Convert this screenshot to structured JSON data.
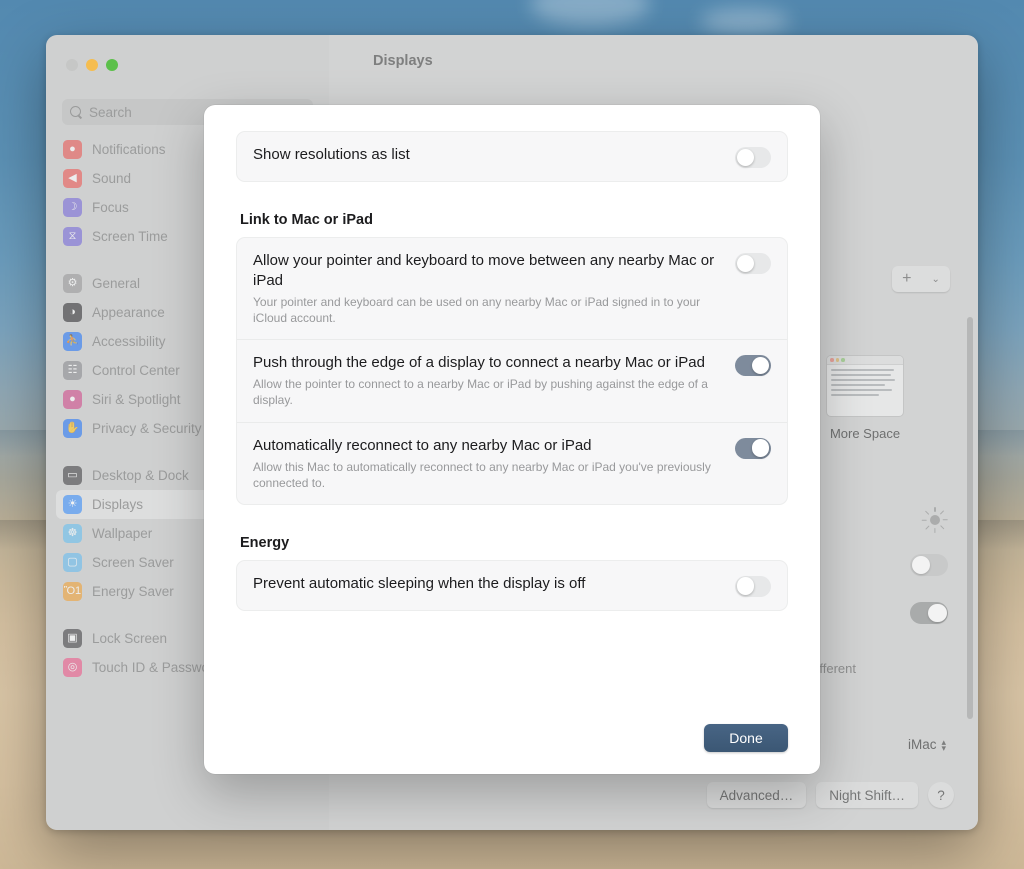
{
  "window": {
    "title": "Displays",
    "traffic_lights": [
      "close",
      "minimize",
      "maximize"
    ]
  },
  "sidebar": {
    "search_placeholder": "Search",
    "groups": [
      {
        "items": [
          {
            "label": "Notifications",
            "icon": "bell-icon",
            "color": "#ea5f5b",
            "glyph": "●",
            "selected": false
          },
          {
            "label": "Sound",
            "icon": "speaker-icon",
            "color": "#ec5e5b",
            "glyph": "◀",
            "selected": false
          },
          {
            "label": "Focus",
            "icon": "moon-icon",
            "color": "#7c6fdb",
            "glyph": "☽",
            "selected": false
          },
          {
            "label": "Screen Time",
            "icon": "hourglass-icon",
            "color": "#7b6fda",
            "glyph": "⧖",
            "selected": false
          }
        ]
      },
      {
        "items": [
          {
            "label": "General",
            "icon": "gear-icon",
            "color": "#9c9c9e",
            "glyph": "⚙",
            "selected": false
          },
          {
            "label": "Appearance",
            "icon": "appearance-icon",
            "color": "#3a3a3c",
            "glyph": "◑",
            "selected": false
          },
          {
            "label": "Accessibility",
            "icon": "accessibility-icon",
            "color": "#2f7bf6",
            "glyph": "⛹",
            "selected": false
          },
          {
            "label": "Control Center",
            "icon": "control-center-icon",
            "color": "#8e8e93",
            "glyph": "☷",
            "selected": false
          },
          {
            "label": "Siri & Spotlight",
            "icon": "siri-icon",
            "color": "#d1518f",
            "glyph": "●",
            "selected": false
          },
          {
            "label": "Privacy & Security",
            "icon": "hand-icon",
            "color": "#2f7bf6",
            "glyph": "✋",
            "selected": false
          }
        ]
      },
      {
        "items": [
          {
            "label": "Desktop & Dock",
            "icon": "desktop-dock-icon",
            "color": "#4a4a4c",
            "glyph": "▭",
            "selected": false
          },
          {
            "label": "Displays",
            "icon": "displays-icon",
            "color": "#3d8ef7",
            "glyph": "☀",
            "selected": true
          },
          {
            "label": "Wallpaper",
            "icon": "wallpaper-icon",
            "color": "#6cc0ef",
            "glyph": "☸",
            "selected": false
          },
          {
            "label": "Screen Saver",
            "icon": "screen-saver-icon",
            "color": "#6cbdef",
            "glyph": "▢",
            "selected": false
          },
          {
            "label": "Energy Saver",
            "icon": "lightbulb-icon",
            "color": "#f0a33c",
            "glyph": "Ὂ1",
            "selected": false
          }
        ]
      },
      {
        "items": [
          {
            "label": "Lock Screen",
            "icon": "lock-screen-icon",
            "color": "#4a4a4c",
            "glyph": "▣",
            "selected": false
          },
          {
            "label": "Touch ID & Password",
            "icon": "touch-id-icon",
            "color": "#ec5f8d",
            "glyph": "◎",
            "selected": false
          }
        ]
      }
    ]
  },
  "content": {
    "add_display_button": {
      "plus": "+",
      "chevron": "⌄"
    },
    "resolution_thumb_label": "More Space",
    "different_text": "fferent",
    "display_popup": {
      "value": "iMac",
      "stepper": "⌃⌄"
    },
    "bottom_buttons": [
      {
        "label": "Advanced…",
        "name": "advanced-button"
      },
      {
        "label": "Night Shift…",
        "name": "night-shift-button"
      },
      {
        "label": "?",
        "name": "help-button"
      }
    ],
    "background_toggles": [
      {
        "state": "off"
      },
      {
        "state": "on"
      }
    ]
  },
  "sheet": {
    "top_row": {
      "title": "Show resolutions as list",
      "toggle": "off"
    },
    "sections": [
      {
        "heading": "Link to Mac or iPad",
        "rows": [
          {
            "title": "Allow your pointer and keyboard to move between any nearby Mac or iPad",
            "description": "Your pointer and keyboard can be used on any nearby Mac or iPad signed in to your iCloud account.",
            "toggle": "off"
          },
          {
            "title": "Push through the edge of a display to connect a nearby Mac or iPad",
            "description": "Allow the pointer to connect to a nearby Mac or iPad by pushing against the edge of a display.",
            "toggle": "on"
          },
          {
            "title": "Automatically reconnect to any nearby Mac or iPad",
            "description": "Allow this Mac to automatically reconnect to any nearby Mac or iPad you've previously connected to.",
            "toggle": "on"
          }
        ]
      },
      {
        "heading": "Energy",
        "rows": [
          {
            "title": "Prevent automatic sleeping when the display is off",
            "description": "",
            "toggle": "off"
          }
        ]
      }
    ],
    "done_label": "Done"
  },
  "colors": {
    "accent_done": "#3b5774",
    "toggle_on": "#7e8b9c",
    "toggle_off": "#e7e8e9",
    "sheet_bg": "#ffffff",
    "window_bg": "#d2d3d3",
    "sidebar_bg": "#cfd0d0"
  }
}
